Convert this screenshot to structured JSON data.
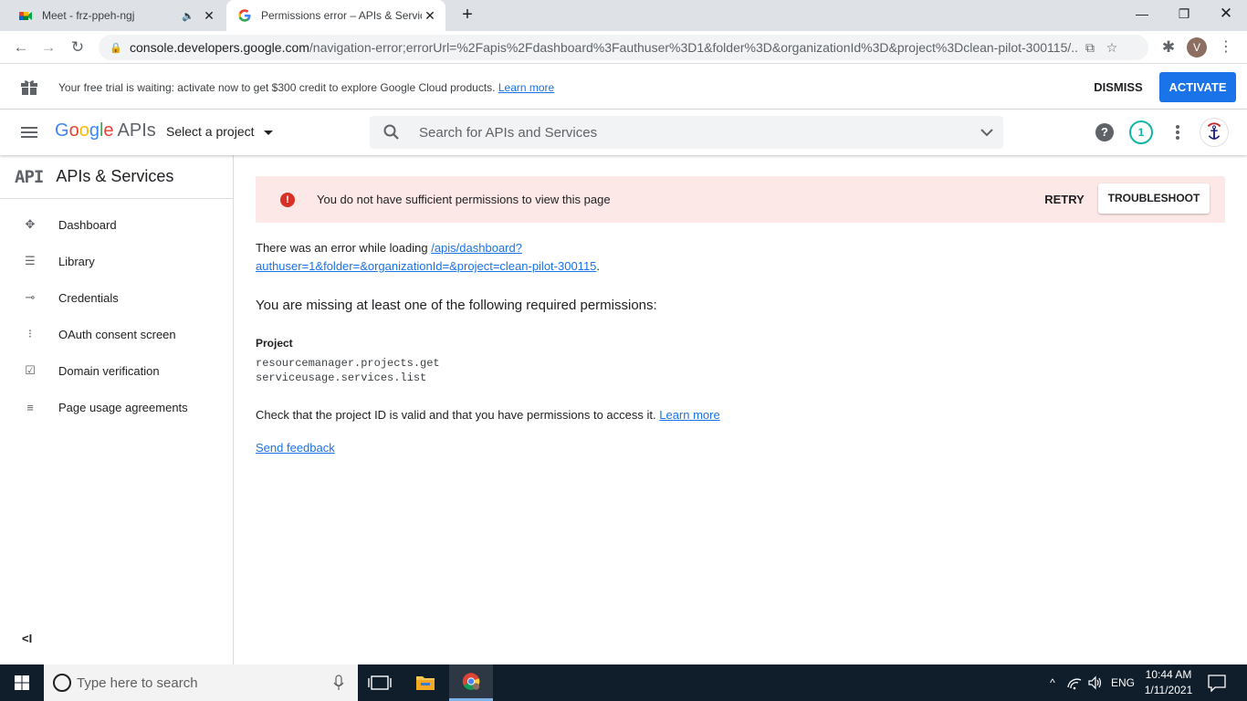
{
  "browser": {
    "tabs": [
      {
        "title": "Meet - frz-ppeh-ngj",
        "icon": "google-meet-icon",
        "audio": "speaker-icon"
      },
      {
        "title": "Permissions error – APIs & Servic",
        "icon": "google-g-icon"
      }
    ],
    "url_host": "console.developers.google.com",
    "url_rest": "/navigation-error;errorUrl=%2Fapis%2Fdashboard%3Fauthuser%3D1&folder%3D&organizationId%3D&project%3Dclean-pilot-300115/...",
    "profile_initial": "V"
  },
  "trial_banner": {
    "message": "Your free trial is waiting: activate now to get $300 credit to explore Google Cloud products.",
    "learn_more": "Learn more",
    "dismiss": "DISMISS",
    "activate": "ACTIVATE"
  },
  "header": {
    "logo_google": [
      "G",
      "o",
      "o",
      "g",
      "l",
      "e"
    ],
    "logo_apis": "APIs",
    "project_selector": "Select a project",
    "search_placeholder": "Search for APIs and Services",
    "help": "?",
    "notifications_count": "1"
  },
  "sidebar": {
    "logo": "API",
    "title": "APIs & Services",
    "items": [
      {
        "label": "Dashboard",
        "icon": "dashboard-icon",
        "glyph": "✥"
      },
      {
        "label": "Library",
        "icon": "library-icon",
        "glyph": "☰"
      },
      {
        "label": "Credentials",
        "icon": "key-icon",
        "glyph": "⊸"
      },
      {
        "label": "OAuth consent screen",
        "icon": "oauth-icon",
        "glyph": "⁝"
      },
      {
        "label": "Domain verification",
        "icon": "checkbox-icon",
        "glyph": "☑"
      },
      {
        "label": "Page usage agreements",
        "icon": "settings-list-icon",
        "glyph": "≡"
      }
    ],
    "collapse": "<I"
  },
  "main": {
    "error_banner": {
      "message": "You do not have sufficient permissions to view this page",
      "retry": "RETRY",
      "troubleshoot": "TROUBLESHOOT"
    },
    "detail_prefix": "There was an error while loading ",
    "detail_link_line1": "/apis/dashboard?",
    "detail_link_line2": "authuser=1&folder=&organizationId=&project=clean-pilot-300115",
    "detail_suffix": ".",
    "missing_heading": "You are missing at least one of the following required permissions:",
    "project_label": "Project",
    "permissions": [
      "resourcemanager.projects.get",
      "serviceusage.services.list"
    ],
    "check_text": "Check that the project ID is valid and that you have permissions to access it.",
    "check_link": "Learn more",
    "send_feedback": "Send feedback"
  },
  "taskbar": {
    "search_placeholder": "Type here to search",
    "language": "ENG",
    "time": "10:44 AM",
    "date": "1/11/2021"
  },
  "colors": {
    "accent": "#1a73e8",
    "error_bg": "#fce8e6",
    "error_icon": "#d93025",
    "taskbar": "#101d2b"
  }
}
